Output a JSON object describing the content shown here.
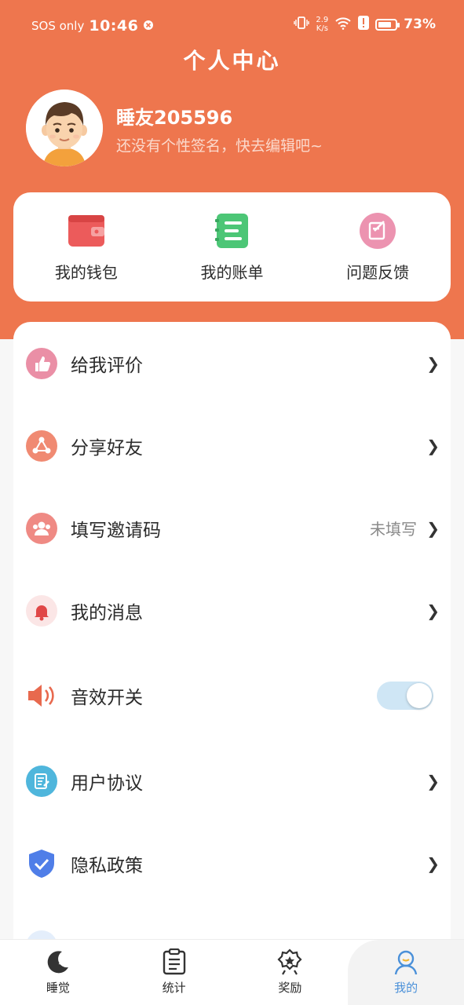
{
  "status_bar": {
    "carrier": "SOS only",
    "time": "10:46",
    "net_speed_value": "2.9",
    "net_speed_unit": "K/s",
    "battery": "73%"
  },
  "header": {
    "title": "个人中心",
    "username": "睡友205596",
    "signature": "还没有个性签名，快去编辑吧~"
  },
  "quick_actions": [
    {
      "label": "我的钱包",
      "icon": "wallet-icon"
    },
    {
      "label": "我的账单",
      "icon": "bill-icon"
    },
    {
      "label": "问题反馈",
      "icon": "feedback-icon"
    }
  ],
  "menu": {
    "rate": {
      "label": "给我评价",
      "icon": "thumbs-up-icon"
    },
    "share": {
      "label": "分享好友",
      "icon": "share-icon"
    },
    "invite": {
      "label": "填写邀请码",
      "value": "未填写",
      "icon": "invite-icon"
    },
    "messages": {
      "label": "我的消息",
      "icon": "bell-icon"
    },
    "sound": {
      "label": "音效开关",
      "enabled": true,
      "icon": "speaker-icon"
    },
    "agreement": {
      "label": "用户协议",
      "icon": "document-icon"
    },
    "privacy": {
      "label": "隐私政策",
      "icon": "shield-icon"
    }
  },
  "chevron": "❯",
  "tabs": [
    {
      "label": "睡觉",
      "icon": "moon-icon"
    },
    {
      "label": "统计",
      "icon": "clipboard-icon"
    },
    {
      "label": "奖励",
      "icon": "badge-icon"
    },
    {
      "label": "我的",
      "icon": "profile-icon",
      "active": true
    }
  ],
  "colors": {
    "brand": "#ee764e",
    "toggle_on": "#cfe6f5",
    "active_tab": "#4a90d9"
  }
}
